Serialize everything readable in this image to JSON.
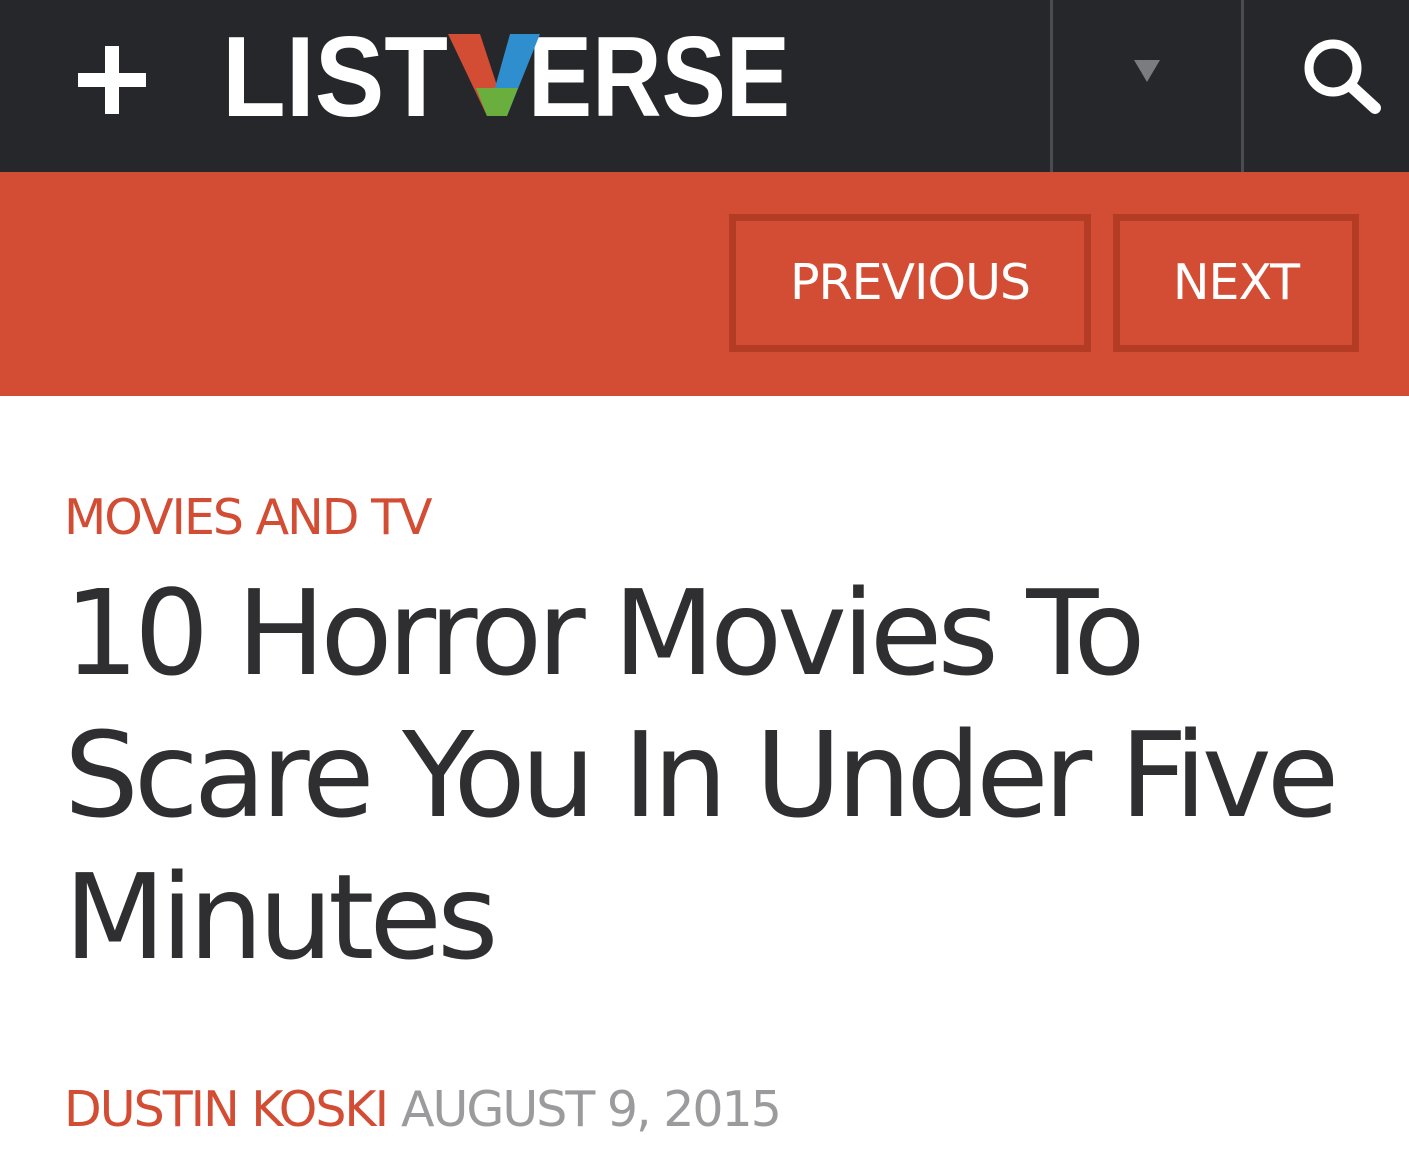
{
  "header": {
    "logo_text": "LISTVERSE",
    "background_color": "#26272b",
    "logo_colors": {
      "text": "#ffffff",
      "v_left": "#d24d33",
      "v_right": "#2f8fce",
      "v_bottom": "#6aaf3d"
    },
    "icons": [
      "plus-icon",
      "dropdown-triangle-icon",
      "search-icon"
    ]
  },
  "nav": {
    "background_color": "#d24d33",
    "previous_label": "PREVIOUS",
    "next_label": "NEXT"
  },
  "article": {
    "category": "MOVIES AND TV",
    "title": "10 Horror Movies To Scare You In Under Five Minutes",
    "author": "DUSTIN KOSKI",
    "date": "AUGUST 9, 2015"
  }
}
